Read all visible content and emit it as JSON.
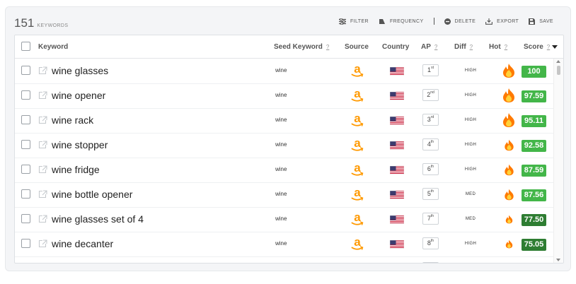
{
  "summary": {
    "count": "151",
    "label": "KEYWORDS"
  },
  "toolbar": {
    "filter": "FILTER",
    "frequency": "FREQUENCY",
    "delete": "DELETE",
    "export": "EXPORT",
    "save": "SAVE"
  },
  "columns": {
    "keyword": "Keyword",
    "seed": "Seed Keyword",
    "source": "Source",
    "country": "Country",
    "ap": "AP",
    "diff": "Diff",
    "hot": "Hot",
    "score": "Score",
    "help": "?"
  },
  "sort": {
    "column": "score",
    "direction": "descending"
  },
  "source_icon": "amazon-logo-icon",
  "country_icon": "us-flag-icon",
  "colors": {
    "score_light": "#43b649",
    "score_dark": "#2e7d32",
    "flame_outer": "#ff7a00",
    "flame_inner": "#ffd23a"
  },
  "rows": [
    {
      "keyword": "wine glasses",
      "seed": "wine",
      "ap_num": "1",
      "ap_suffix": "st",
      "diff": "HIGH",
      "hot_level": 3,
      "score": "100"
    },
    {
      "keyword": "wine opener",
      "seed": "wine",
      "ap_num": "2",
      "ap_suffix": "nd",
      "diff": "HIGH",
      "hot_level": 3,
      "score": "97.59"
    },
    {
      "keyword": "wine rack",
      "seed": "wine",
      "ap_num": "3",
      "ap_suffix": "rd",
      "diff": "HIGH",
      "hot_level": 3,
      "score": "95.11"
    },
    {
      "keyword": "wine stopper",
      "seed": "wine",
      "ap_num": "4",
      "ap_suffix": "th",
      "diff": "HIGH",
      "hot_level": 2,
      "score": "92.58"
    },
    {
      "keyword": "wine fridge",
      "seed": "wine",
      "ap_num": "6",
      "ap_suffix": "th",
      "diff": "HIGH",
      "hot_level": 2,
      "score": "87.59"
    },
    {
      "keyword": "wine bottle opener",
      "seed": "wine",
      "ap_num": "5",
      "ap_suffix": "th",
      "diff": "MED",
      "hot_level": 2,
      "score": "87.56"
    },
    {
      "keyword": "wine glasses set of 4",
      "seed": "wine",
      "ap_num": "7",
      "ap_suffix": "th",
      "diff": "MED",
      "hot_level": 1,
      "score": "77.50"
    },
    {
      "keyword": "wine decanter",
      "seed": "wine",
      "ap_num": "8",
      "ap_suffix": "th",
      "diff": "HIGH",
      "hot_level": 1,
      "score": "75.05"
    }
  ]
}
